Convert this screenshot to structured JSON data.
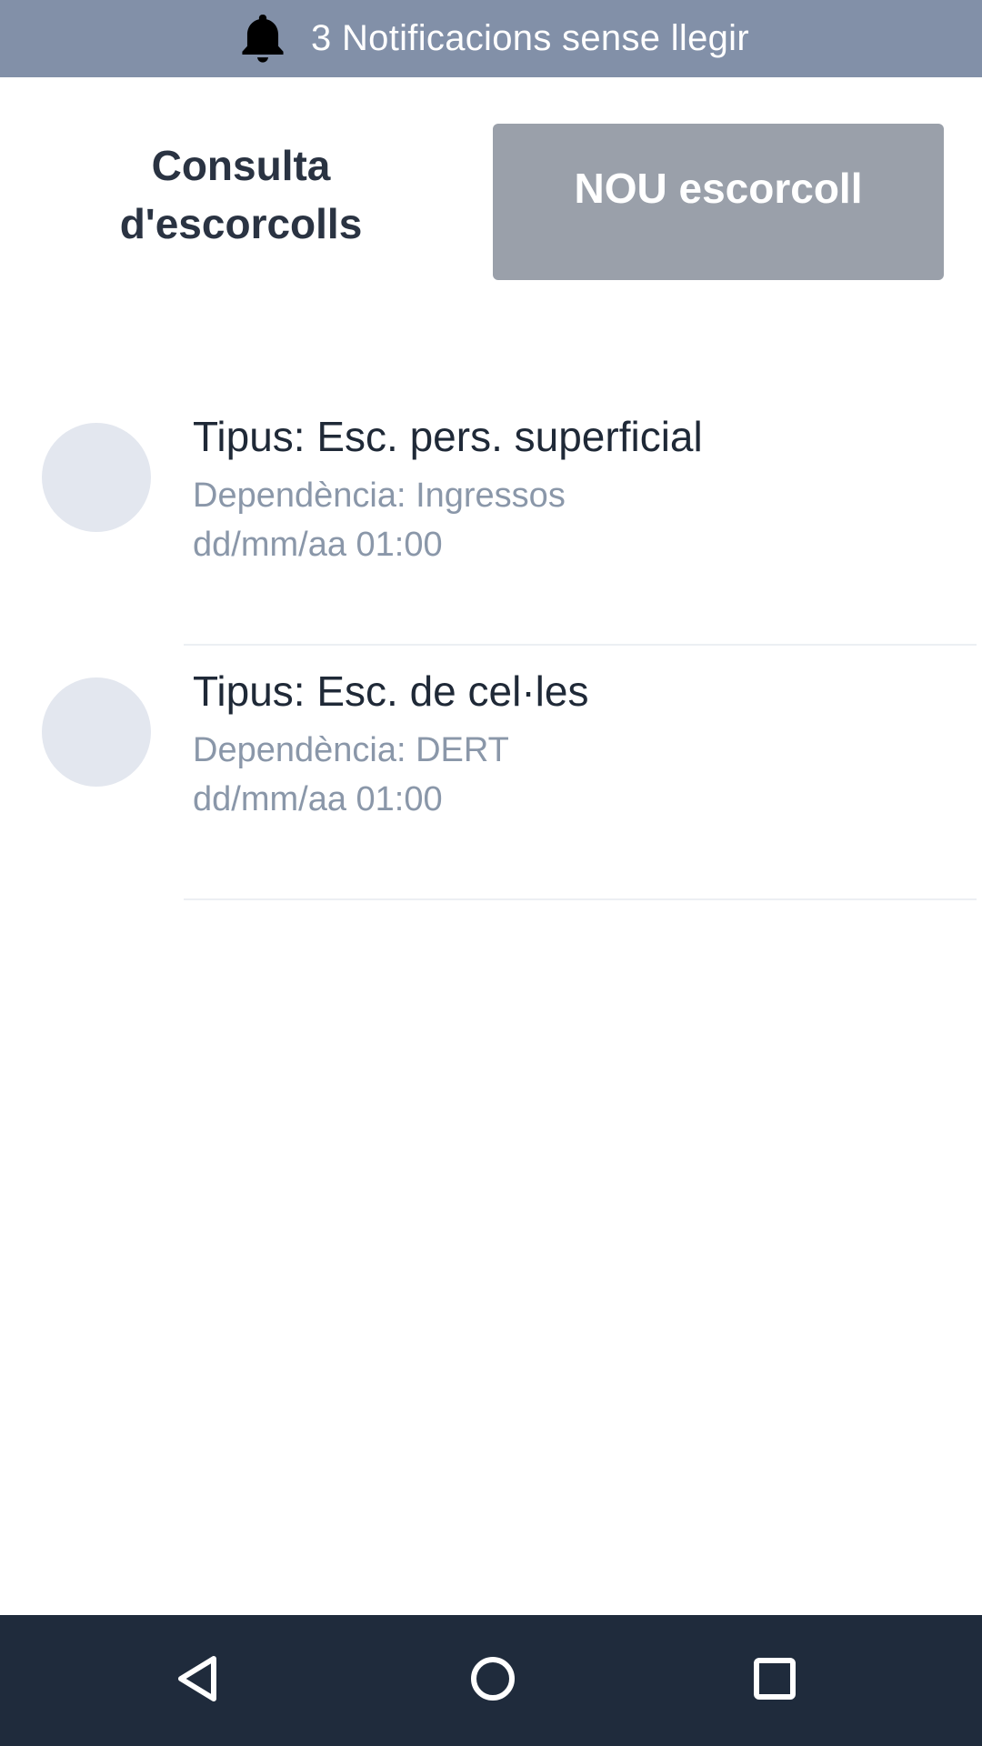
{
  "notifications": {
    "icon": "bell-icon",
    "text": "3 Notificacions sense llegir"
  },
  "header": {
    "title_line1": "Consulta",
    "title_line2": "d'escorcolls",
    "new_button_label": "NOU escorcoll"
  },
  "list": {
    "items": [
      {
        "title": "Tipus: Esc. pers. superficial",
        "dependency": "Dependència: Ingressos",
        "date": "dd/mm/aa 01:00"
      },
      {
        "title": "Tipus: Esc. de cel·les",
        "dependency": "Dependència: DERT",
        "date": "dd/mm/aa 01:00"
      }
    ]
  },
  "nav": {
    "back_icon": "back-triangle-icon",
    "home_icon": "home-circle-icon",
    "recents_icon": "recents-square-icon"
  },
  "colors": {
    "notification_bar": "#8290a8",
    "button": "#9aa0aa",
    "nav_bar": "#1f2b3c",
    "avatar": "#e3e7ef",
    "secondary_text": "#8a97a9"
  }
}
